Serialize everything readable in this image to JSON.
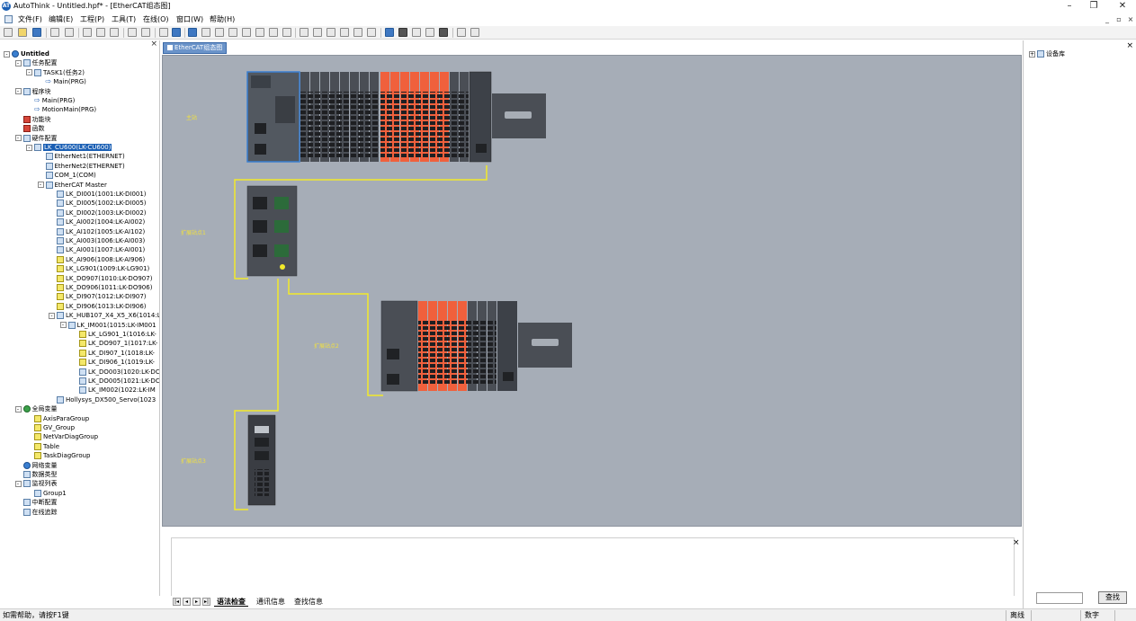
{
  "window": {
    "title": "AutoThink - Untitled.hpf* - [EtherCAT组态图]",
    "app_icon": "AT",
    "controls": [
      "–",
      "❐",
      "✕"
    ]
  },
  "menu": {
    "items": [
      "文件(F)",
      "编辑(E)",
      "工程(P)",
      "工具(T)",
      "在线(O)",
      "窗口(W)",
      "帮助(H)"
    ],
    "mdi_controls": [
      "_",
      "▫",
      "×"
    ]
  },
  "tree": {
    "rows": [
      {
        "label": "Untitled",
        "depth": 0,
        "ex": "-",
        "icon": "globe",
        "bold": true
      },
      {
        "label": "任务配置",
        "depth": 1,
        "ex": "-",
        "icon": "blue"
      },
      {
        "label": "TASK1(任务2)",
        "depth": 2,
        "ex": "-",
        "icon": "blue"
      },
      {
        "label": "Main(PRG)",
        "depth": 3,
        "ex": "",
        "icon": "arrow"
      },
      {
        "label": "程序块",
        "depth": 1,
        "ex": "-",
        "icon": "blue"
      },
      {
        "label": "Main(PRG)",
        "depth": 2,
        "ex": "",
        "icon": "arrow"
      },
      {
        "label": "MotionMain(PRG)",
        "depth": 2,
        "ex": "",
        "icon": "arrow"
      },
      {
        "label": "功能块",
        "depth": 1,
        "ex": "",
        "icon": "red"
      },
      {
        "label": "函数",
        "depth": 1,
        "ex": "",
        "icon": "red"
      },
      {
        "label": "硬件配置",
        "depth": 1,
        "ex": "-",
        "icon": "blue"
      },
      {
        "label": "LK_CU600(LK-CU600)",
        "depth": 2,
        "ex": "-",
        "icon": "blue",
        "selected": true
      },
      {
        "label": "EtherNet1(ETHERNET)",
        "depth": 3,
        "ex": "",
        "icon": "blue"
      },
      {
        "label": "EtherNet2(ETHERNET)",
        "depth": 3,
        "ex": "",
        "icon": "blue"
      },
      {
        "label": "COM_1(COM)",
        "depth": 3,
        "ex": "",
        "icon": "blue"
      },
      {
        "label": "EtherCAT Master",
        "depth": 3,
        "ex": "-",
        "icon": "blue"
      },
      {
        "label": "LK_DI001(1001:LK-DI001)",
        "depth": 4,
        "ex": "",
        "icon": "blue"
      },
      {
        "label": "LK_DI005(1002:LK-DI005)",
        "depth": 4,
        "ex": "",
        "icon": "blue"
      },
      {
        "label": "LK_DI002(1003:LK-DI002)",
        "depth": 4,
        "ex": "",
        "icon": "blue"
      },
      {
        "label": "LK_AI002(1004:LK-AI002)",
        "depth": 4,
        "ex": "",
        "icon": "blue"
      },
      {
        "label": "LK_AI102(1005:LK-AI102)",
        "depth": 4,
        "ex": "",
        "icon": "blue"
      },
      {
        "label": "LK_AI003(1006:LK-AI003)",
        "depth": 4,
        "ex": "",
        "icon": "blue"
      },
      {
        "label": "LK_AI001(1007:LK-AI001)",
        "depth": 4,
        "ex": "",
        "icon": "blue"
      },
      {
        "label": "LK_AI906(1008:LK-AI906)",
        "depth": 4,
        "ex": "",
        "icon": "yellow"
      },
      {
        "label": "LK_LG901(1009:LK-LG901)",
        "depth": 4,
        "ex": "",
        "icon": "yellow"
      },
      {
        "label": "LK_DO907(1010:LK-DO907)",
        "depth": 4,
        "ex": "",
        "icon": "yellow"
      },
      {
        "label": "LK_DO906(1011:LK-DO906)",
        "depth": 4,
        "ex": "",
        "icon": "yellow"
      },
      {
        "label": "LK_DI907(1012:LK-DI907)",
        "depth": 4,
        "ex": "",
        "icon": "yellow"
      },
      {
        "label": "LK_DI906(1013:LK-DI906)",
        "depth": 4,
        "ex": "",
        "icon": "yellow"
      },
      {
        "label": "LK_HUB107_X4_X5_X6(1014:L",
        "depth": 4,
        "ex": "-",
        "icon": "blue"
      },
      {
        "label": "LK_IM001(1015:LK-IM001",
        "depth": 5,
        "ex": "-",
        "icon": "blue"
      },
      {
        "label": "LK_LG901_1(1016:LK-",
        "depth": 6,
        "ex": "",
        "icon": "yellow"
      },
      {
        "label": "LK_DO907_1(1017:LK-",
        "depth": 6,
        "ex": "",
        "icon": "yellow"
      },
      {
        "label": "LK_DI907_1(1018:LK-",
        "depth": 6,
        "ex": "",
        "icon": "yellow"
      },
      {
        "label": "LK_DI906_1(1019:LK-",
        "depth": 6,
        "ex": "",
        "icon": "yellow"
      },
      {
        "label": "LK_DO003(1020:LK-DC",
        "depth": 6,
        "ex": "",
        "icon": "blue"
      },
      {
        "label": "LK_DO005(1021:LK-DC",
        "depth": 6,
        "ex": "",
        "icon": "blue"
      },
      {
        "label": "LK_IM002(1022:LK-IM",
        "depth": 6,
        "ex": "",
        "icon": "blue"
      },
      {
        "label": "Hollysys_DX500_Servo(1023",
        "depth": 4,
        "ex": "",
        "icon": "blue"
      },
      {
        "label": "全局变量",
        "depth": 1,
        "ex": "-",
        "icon": "green"
      },
      {
        "label": "AxisParaGroup",
        "depth": 2,
        "ex": "",
        "icon": "yellow"
      },
      {
        "label": "GV_Group",
        "depth": 2,
        "ex": "",
        "icon": "yellow"
      },
      {
        "label": "NetVarDiagGroup",
        "depth": 2,
        "ex": "",
        "icon": "yellow"
      },
      {
        "label": "Table",
        "depth": 2,
        "ex": "",
        "icon": "yellow"
      },
      {
        "label": "TaskDiagGroup",
        "depth": 2,
        "ex": "",
        "icon": "yellow"
      },
      {
        "label": "网络变量",
        "depth": 1,
        "ex": "",
        "icon": "globe"
      },
      {
        "label": "数据类型",
        "depth": 1,
        "ex": "",
        "icon": "blue"
      },
      {
        "label": "监视列表",
        "depth": 1,
        "ex": "-",
        "icon": "blue"
      },
      {
        "label": "Group1",
        "depth": 2,
        "ex": "",
        "icon": "blue"
      },
      {
        "label": "中断配置",
        "depth": 1,
        "ex": "",
        "icon": "blue"
      },
      {
        "label": "在线追踪",
        "depth": 1,
        "ex": "",
        "icon": "blue"
      }
    ]
  },
  "document": {
    "tab_label": "EtherCAT组态图"
  },
  "canvas": {
    "stations": [
      "主站",
      "扩展站点1",
      "扩展站点2",
      "扩展站点3"
    ],
    "colors": {
      "background": "#a6adb7",
      "link": "#f2ea2a",
      "io_orange": "#f0603c",
      "module_dark": "#4a4e55"
    }
  },
  "output": {
    "tabs": [
      "语法检查",
      "通讯信息",
      "查找信息"
    ]
  },
  "right_panel": {
    "tree_label": "设备库",
    "search_value": "",
    "search_button": "查找"
  },
  "status": {
    "help_text": "如需帮助，请按F1键",
    "cells": [
      "离线",
      "",
      "数字",
      ""
    ]
  }
}
